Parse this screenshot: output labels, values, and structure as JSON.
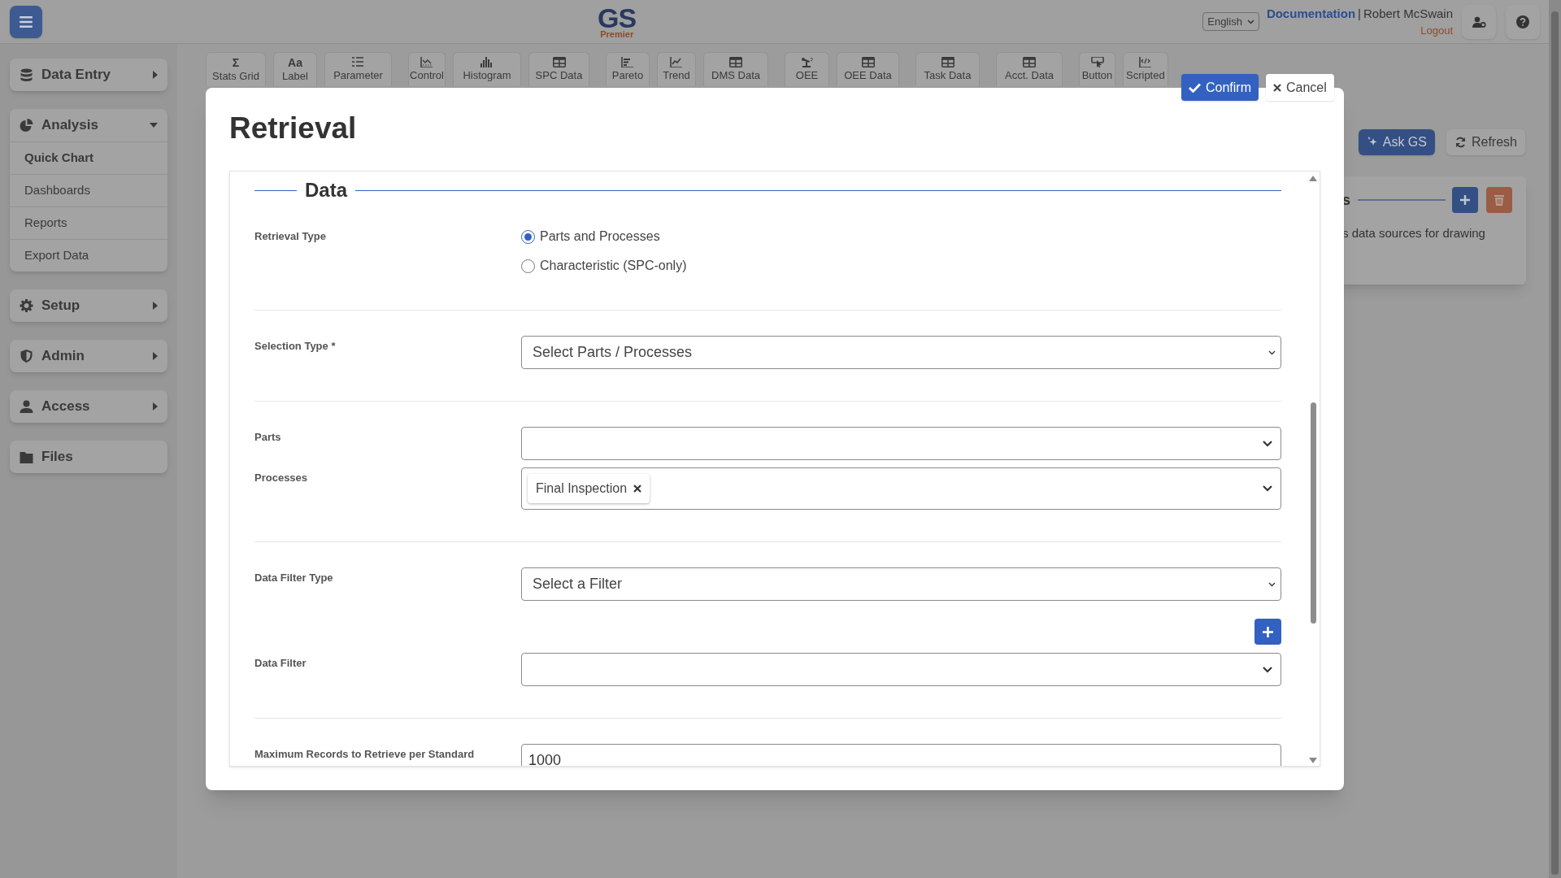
{
  "header": {
    "logo": {
      "title": "GS",
      "subtitle": "Premier"
    },
    "language": "English",
    "documentation_link": "Documentation",
    "separator": "|",
    "user_name": "Robert McSwain",
    "logout_link": "Logout"
  },
  "sidebar": [
    {
      "label": "Data Entry",
      "expanded": false
    },
    {
      "label": "Analysis",
      "expanded": true,
      "children": [
        {
          "label": "Quick Chart",
          "selected": true
        },
        {
          "label": "Dashboards",
          "selected": false
        },
        {
          "label": "Reports",
          "selected": false
        },
        {
          "label": "Export Data",
          "selected": false
        }
      ]
    },
    {
      "label": "Setup",
      "expanded": false
    },
    {
      "label": "Admin",
      "expanded": false
    },
    {
      "label": "Access",
      "expanded": false
    },
    {
      "label": "Files"
    }
  ],
  "toolbar": [
    [
      {
        "label": "Stats Grid",
        "icon_text": "Σ"
      },
      {
        "label": "Label",
        "icon_text": "Aa"
      },
      {
        "label": "Parameter"
      }
    ],
    [
      {
        "label": "Control"
      },
      {
        "label": "Histogram"
      },
      {
        "label": "SPC Data"
      }
    ],
    [
      {
        "label": "Pareto"
      },
      {
        "label": "Trend"
      },
      {
        "label": "DMS Data"
      }
    ],
    [
      {
        "label": "OEE"
      },
      {
        "label": "OEE Data"
      }
    ],
    [
      {
        "label": "Task Data"
      }
    ],
    [
      {
        "label": "Acct. Data"
      }
    ],
    [
      {
        "label": "Button"
      },
      {
        "label": "Scripted"
      }
    ]
  ],
  "background_actions": [
    {
      "label": "Ask GS",
      "kind": "primary"
    },
    {
      "label": "Refresh",
      "kind": "secondary"
    }
  ],
  "background_card": {
    "title": "s",
    "description": "s data sources for drawing"
  },
  "modal": {
    "title": "Retrieval",
    "actions": [
      {
        "label": "Confirm",
        "kind": "primary"
      },
      {
        "label": "Cancel",
        "kind": "secondary"
      }
    ],
    "section": "Data",
    "groups": [
      [
        {
          "kind": "radio",
          "label": "Retrieval Type",
          "options": [
            {
              "label": "Parts and Processes",
              "selected": true
            },
            {
              "label": "Characteristic (SPC-only)",
              "selected": false
            }
          ]
        }
      ],
      [
        {
          "kind": "select",
          "label": "Selection Type *",
          "value": "Select Parts / Processes"
        }
      ],
      [
        {
          "kind": "multiselect",
          "label": "Parts"
        },
        {
          "kind": "multiselect",
          "label": "Processes",
          "chips": [
            "Final Inspection"
          ]
        }
      ],
      [
        {
          "kind": "select",
          "label": "Data Filter Type",
          "value": "Select a Filter"
        },
        {
          "kind": "add_button"
        },
        {
          "kind": "multiselect",
          "label": "Data Filter"
        }
      ],
      [
        {
          "kind": "input",
          "label": "Maximum Records to Retrieve per Standard",
          "value": "1000"
        }
      ]
    ]
  }
}
